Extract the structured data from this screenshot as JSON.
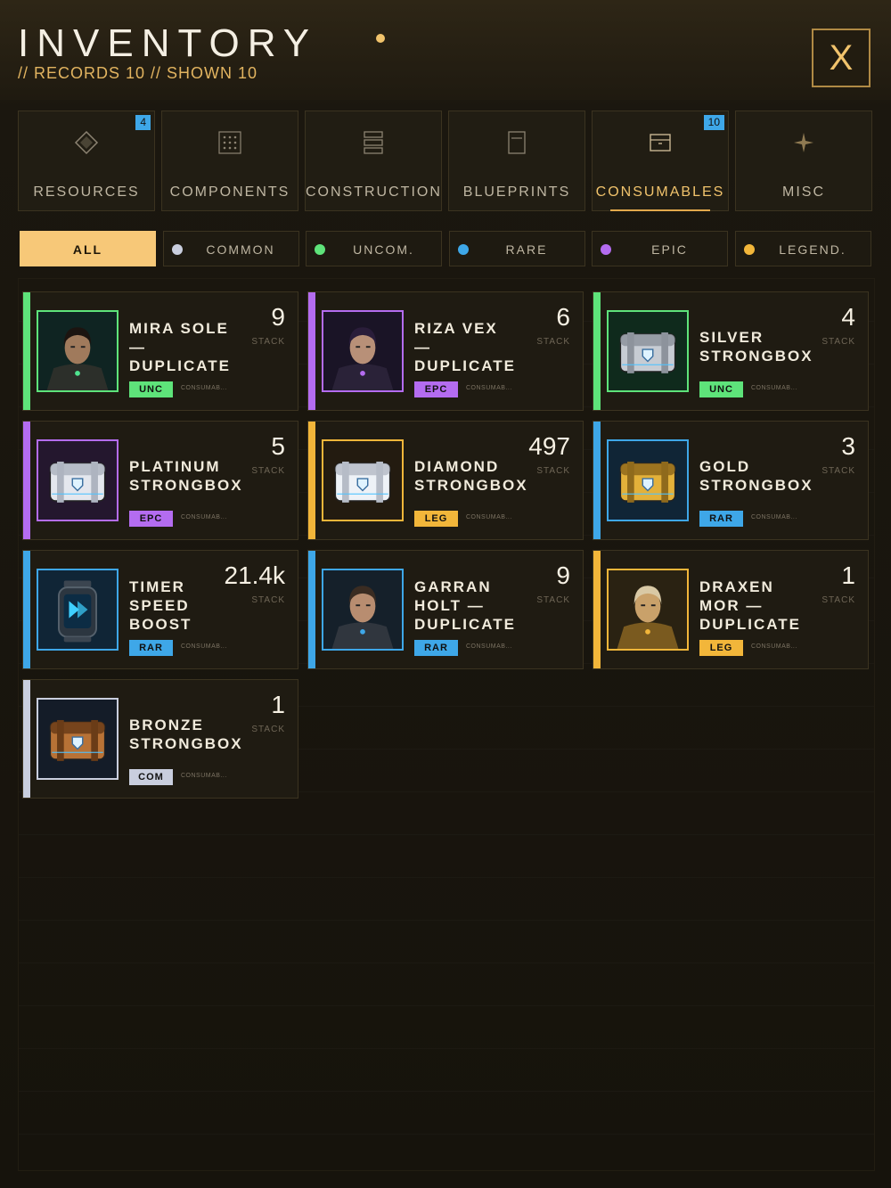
{
  "header": {
    "title": "INVENTORY",
    "subtitle": "// RECORDS 10 // SHOWN 10",
    "close_label": "X",
    "accent": "#f1c36c"
  },
  "tabs": [
    {
      "label": "RESOURCES",
      "icon": "diamond-icon",
      "badge": "4",
      "active": false
    },
    {
      "label": "COMPONENTS",
      "icon": "grid-dots-icon",
      "badge": "",
      "active": false
    },
    {
      "label": "CONSTRUCTION",
      "icon": "stack-layers-icon",
      "badge": "",
      "active": false
    },
    {
      "label": "BLUEPRINTS",
      "icon": "document-icon",
      "badge": "",
      "active": false
    },
    {
      "label": "CONSUMABLES",
      "icon": "box-icon",
      "badge": "10",
      "active": true
    },
    {
      "label": "MISC",
      "icon": "sparkle-icon",
      "badge": "",
      "active": false
    }
  ],
  "filters": [
    {
      "label": "ALL",
      "color": "",
      "active": true
    },
    {
      "label": "COMMON",
      "color": "#c9cede",
      "active": false
    },
    {
      "label": "UNCOM.",
      "color": "#5ee37a",
      "active": false
    },
    {
      "label": "RARE",
      "color": "#3ea7e8",
      "active": false
    },
    {
      "label": "EPIC",
      "color": "#b46cf0",
      "active": false
    },
    {
      "label": "LEGEND.",
      "color": "#f2b63a",
      "active": false
    }
  ],
  "rarity_colors": {
    "UNC": "#5ee37a",
    "EPC": "#b46cf0",
    "LEG": "#f2b63a",
    "RAR": "#3ea7e8",
    "COM": "#c9cede"
  },
  "items": [
    {
      "name": "MIRA SOLE\n—\nDUPLICATE",
      "count": "9",
      "stack_label": "STACK",
      "rarity": "UNC",
      "category": "CONSUMAB...",
      "icon": "mira-portrait-icon"
    },
    {
      "name": "RIZA VEX\n—\nDUPLICATE",
      "count": "6",
      "stack_label": "STACK",
      "rarity": "EPC",
      "category": "CONSUMAB...",
      "icon": "riza-portrait-icon"
    },
    {
      "name": "SILVER\nSTRONGBOX",
      "count": "4",
      "stack_label": "STACK",
      "rarity": "UNC",
      "category": "CONSUMAB...",
      "icon": "silver-strongbox-icon"
    },
    {
      "name": "PLATINUM\nSTRONGBOX",
      "count": "5",
      "stack_label": "STACK",
      "rarity": "EPC",
      "category": "CONSUMAB...",
      "icon": "platinum-strongbox-icon"
    },
    {
      "name": "DIAMOND\nSTRONGBOX",
      "count": "497",
      "stack_label": "STACK",
      "rarity": "LEG",
      "category": "CONSUMAB...",
      "icon": "diamond-strongbox-icon"
    },
    {
      "name": "GOLD\nSTRONGBOX",
      "count": "3",
      "stack_label": "STACK",
      "rarity": "RAR",
      "category": "CONSUMAB...",
      "icon": "gold-strongbox-icon"
    },
    {
      "name": "TIMER\nSPEED\nBOOST",
      "count": "21.4k",
      "stack_label": "STACK",
      "rarity": "RAR",
      "category": "CONSUMAB...",
      "icon": "timer-boost-icon"
    },
    {
      "name": "GARRAN\nHOLT —\nDUPLICATE",
      "count": "9",
      "stack_label": "STACK",
      "rarity": "RAR",
      "category": "CONSUMAB...",
      "icon": "garran-portrait-icon"
    },
    {
      "name": "DRAXEN\nMOR —\nDUPLICATE",
      "count": "1",
      "stack_label": "STACK",
      "rarity": "LEG",
      "category": "CONSUMAB...",
      "icon": "draxen-portrait-icon"
    },
    {
      "name": "BRONZE\nSTRONGBOX",
      "count": "1",
      "stack_label": "STACK",
      "rarity": "COM",
      "category": "CONSUMAB...",
      "icon": "bronze-strongbox-icon"
    }
  ]
}
